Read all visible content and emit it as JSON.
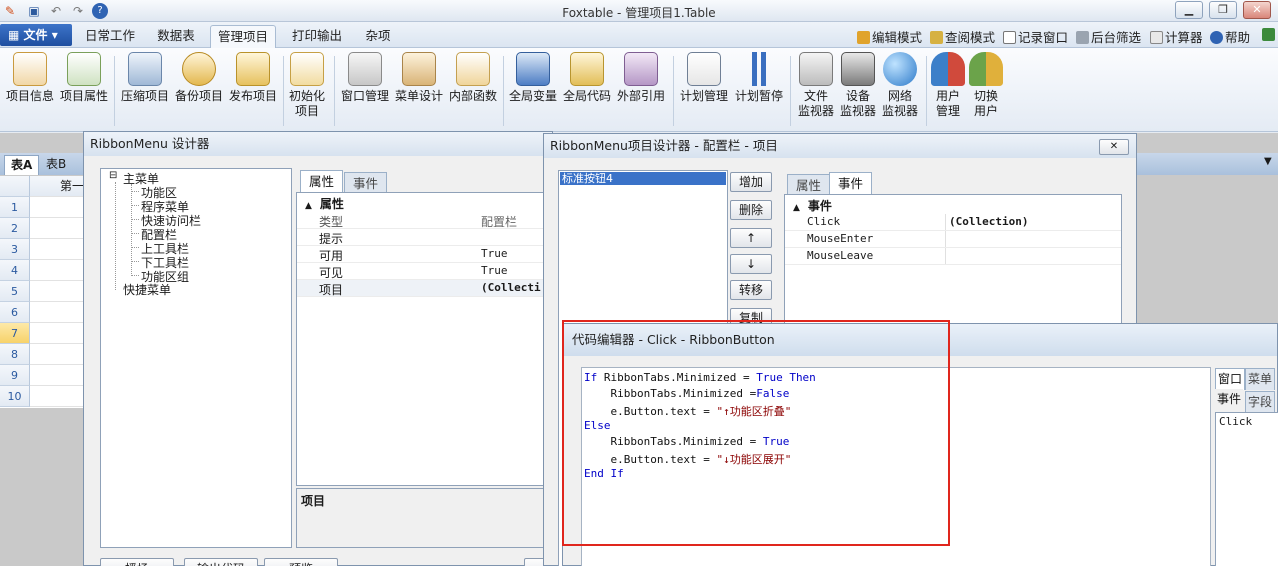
{
  "window": {
    "title": "Foxtable - 管理项目1.Table"
  },
  "menu": {
    "file": "文件",
    "tabs": [
      "日常工作",
      "数据表",
      "管理项目",
      "打印输出",
      "杂项"
    ],
    "right_tools": [
      "编辑模式",
      "查阅模式",
      "记录窗口",
      "后台筛选",
      "计算器",
      "帮助"
    ]
  },
  "ribbon": {
    "buttons": [
      "项目信息",
      "项目属性",
      "压缩项目",
      "备份项目",
      "发布项目",
      "初始化\n项目",
      "窗口管理",
      "菜单设计",
      "内部函数",
      "全局变量",
      "全局代码",
      "外部引用",
      "计划管理",
      "计划暂停",
      "文件\n监视器",
      "设备\n监视器",
      "网络\n监视器",
      "用户\n管理",
      "切换\n用户"
    ]
  },
  "sheet": {
    "tabs": [
      "表A",
      "表B"
    ],
    "col_header": "第一",
    "rows": [
      "1",
      "2",
      "3",
      "4",
      "5",
      "6",
      "7",
      "8",
      "9",
      "10"
    ]
  },
  "designer": {
    "title": "RibbonMenu 设计器",
    "tree": {
      "root": "主菜单",
      "children": [
        "功能区",
        "程序菜单",
        "快速访问栏",
        "配置栏",
        "上工具栏",
        "下工具栏",
        "功能区组"
      ],
      "second_root": "快捷菜单"
    },
    "tabs": [
      "属性",
      "事件"
    ],
    "group": "属性",
    "props": [
      {
        "k": "类型",
        "v": "配置栏"
      },
      {
        "k": "提示",
        "v": ""
      },
      {
        "k": "可用",
        "v": "True"
      },
      {
        "k": "可见",
        "v": "True"
      },
      {
        "k": "项目",
        "v": "(Collecti"
      }
    ],
    "desc_label": "项目",
    "bottom_buttons": [
      "播场",
      "输出代码",
      "预览"
    ]
  },
  "item_designer": {
    "title": "RibbonMenu项目设计器 - 配置栏 - 项目",
    "list_items": [
      "标准按钮4"
    ],
    "buttons": [
      "增加",
      "删除",
      "↑",
      "↓",
      "转移",
      "复制"
    ],
    "tabs": [
      "属性",
      "事件"
    ],
    "group": "事件",
    "events": [
      {
        "k": "Click",
        "v": "(Collection)"
      },
      {
        "k": "MouseEnter",
        "v": ""
      },
      {
        "k": "MouseLeave",
        "v": ""
      }
    ]
  },
  "code_editor": {
    "title": "代码编辑器 - Click - RibbonButton",
    "lines": [
      {
        "indent": "",
        "parts": [
          [
            "kw",
            "If "
          ],
          [
            "",
            "RibbonTabs.Minimized = "
          ],
          [
            "kw",
            "True Then"
          ]
        ]
      },
      {
        "indent": "    ",
        "parts": [
          [
            "",
            "RibbonTabs.Minimized ="
          ],
          [
            "kw",
            "False"
          ]
        ]
      },
      {
        "indent": "    ",
        "parts": [
          [
            "",
            "e.Button.text = "
          ],
          [
            "str",
            "\"↑功能区折叠\""
          ]
        ]
      },
      {
        "indent": "",
        "parts": [
          [
            "kw",
            "Else"
          ]
        ]
      },
      {
        "indent": "    ",
        "parts": [
          [
            "",
            "RibbonTabs.Minimized = "
          ],
          [
            "kw",
            "True"
          ]
        ]
      },
      {
        "indent": "    ",
        "parts": [
          [
            "",
            "e.Button.text = "
          ],
          [
            "str",
            "\"↓功能区展开\""
          ]
        ]
      },
      {
        "indent": "",
        "parts": [
          [
            "kw",
            "End If"
          ]
        ]
      }
    ],
    "side_tabs": [
      "窗口",
      "菜单",
      "事件",
      "字段"
    ],
    "side_list": [
      "Click"
    ]
  },
  "colors": {
    "accent": "#1f4fa0",
    "highlight": "#e0261d",
    "keyword": "#0000c8",
    "string": "#8b0000"
  }
}
